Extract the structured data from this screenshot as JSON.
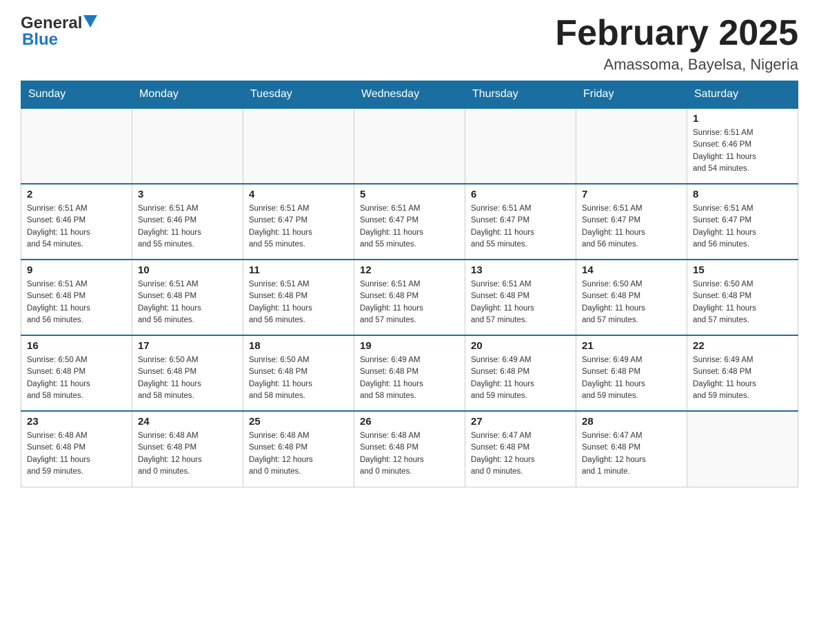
{
  "header": {
    "logo_general": "General",
    "logo_blue": "Blue",
    "month_title": "February 2025",
    "location": "Amassoma, Bayelsa, Nigeria"
  },
  "weekdays": [
    "Sunday",
    "Monday",
    "Tuesday",
    "Wednesday",
    "Thursday",
    "Friday",
    "Saturday"
  ],
  "weeks": [
    [
      {
        "day": "",
        "info": ""
      },
      {
        "day": "",
        "info": ""
      },
      {
        "day": "",
        "info": ""
      },
      {
        "day": "",
        "info": ""
      },
      {
        "day": "",
        "info": ""
      },
      {
        "day": "",
        "info": ""
      },
      {
        "day": "1",
        "info": "Sunrise: 6:51 AM\nSunset: 6:46 PM\nDaylight: 11 hours\nand 54 minutes."
      }
    ],
    [
      {
        "day": "2",
        "info": "Sunrise: 6:51 AM\nSunset: 6:46 PM\nDaylight: 11 hours\nand 54 minutes."
      },
      {
        "day": "3",
        "info": "Sunrise: 6:51 AM\nSunset: 6:46 PM\nDaylight: 11 hours\nand 55 minutes."
      },
      {
        "day": "4",
        "info": "Sunrise: 6:51 AM\nSunset: 6:47 PM\nDaylight: 11 hours\nand 55 minutes."
      },
      {
        "day": "5",
        "info": "Sunrise: 6:51 AM\nSunset: 6:47 PM\nDaylight: 11 hours\nand 55 minutes."
      },
      {
        "day": "6",
        "info": "Sunrise: 6:51 AM\nSunset: 6:47 PM\nDaylight: 11 hours\nand 55 minutes."
      },
      {
        "day": "7",
        "info": "Sunrise: 6:51 AM\nSunset: 6:47 PM\nDaylight: 11 hours\nand 56 minutes."
      },
      {
        "day": "8",
        "info": "Sunrise: 6:51 AM\nSunset: 6:47 PM\nDaylight: 11 hours\nand 56 minutes."
      }
    ],
    [
      {
        "day": "9",
        "info": "Sunrise: 6:51 AM\nSunset: 6:48 PM\nDaylight: 11 hours\nand 56 minutes."
      },
      {
        "day": "10",
        "info": "Sunrise: 6:51 AM\nSunset: 6:48 PM\nDaylight: 11 hours\nand 56 minutes."
      },
      {
        "day": "11",
        "info": "Sunrise: 6:51 AM\nSunset: 6:48 PM\nDaylight: 11 hours\nand 56 minutes."
      },
      {
        "day": "12",
        "info": "Sunrise: 6:51 AM\nSunset: 6:48 PM\nDaylight: 11 hours\nand 57 minutes."
      },
      {
        "day": "13",
        "info": "Sunrise: 6:51 AM\nSunset: 6:48 PM\nDaylight: 11 hours\nand 57 minutes."
      },
      {
        "day": "14",
        "info": "Sunrise: 6:50 AM\nSunset: 6:48 PM\nDaylight: 11 hours\nand 57 minutes."
      },
      {
        "day": "15",
        "info": "Sunrise: 6:50 AM\nSunset: 6:48 PM\nDaylight: 11 hours\nand 57 minutes."
      }
    ],
    [
      {
        "day": "16",
        "info": "Sunrise: 6:50 AM\nSunset: 6:48 PM\nDaylight: 11 hours\nand 58 minutes."
      },
      {
        "day": "17",
        "info": "Sunrise: 6:50 AM\nSunset: 6:48 PM\nDaylight: 11 hours\nand 58 minutes."
      },
      {
        "day": "18",
        "info": "Sunrise: 6:50 AM\nSunset: 6:48 PM\nDaylight: 11 hours\nand 58 minutes."
      },
      {
        "day": "19",
        "info": "Sunrise: 6:49 AM\nSunset: 6:48 PM\nDaylight: 11 hours\nand 58 minutes."
      },
      {
        "day": "20",
        "info": "Sunrise: 6:49 AM\nSunset: 6:48 PM\nDaylight: 11 hours\nand 59 minutes."
      },
      {
        "day": "21",
        "info": "Sunrise: 6:49 AM\nSunset: 6:48 PM\nDaylight: 11 hours\nand 59 minutes."
      },
      {
        "day": "22",
        "info": "Sunrise: 6:49 AM\nSunset: 6:48 PM\nDaylight: 11 hours\nand 59 minutes."
      }
    ],
    [
      {
        "day": "23",
        "info": "Sunrise: 6:48 AM\nSunset: 6:48 PM\nDaylight: 11 hours\nand 59 minutes."
      },
      {
        "day": "24",
        "info": "Sunrise: 6:48 AM\nSunset: 6:48 PM\nDaylight: 12 hours\nand 0 minutes."
      },
      {
        "day": "25",
        "info": "Sunrise: 6:48 AM\nSunset: 6:48 PM\nDaylight: 12 hours\nand 0 minutes."
      },
      {
        "day": "26",
        "info": "Sunrise: 6:48 AM\nSunset: 6:48 PM\nDaylight: 12 hours\nand 0 minutes."
      },
      {
        "day": "27",
        "info": "Sunrise: 6:47 AM\nSunset: 6:48 PM\nDaylight: 12 hours\nand 0 minutes."
      },
      {
        "day": "28",
        "info": "Sunrise: 6:47 AM\nSunset: 6:48 PM\nDaylight: 12 hours\nand 1 minute."
      },
      {
        "day": "",
        "info": ""
      }
    ]
  ]
}
